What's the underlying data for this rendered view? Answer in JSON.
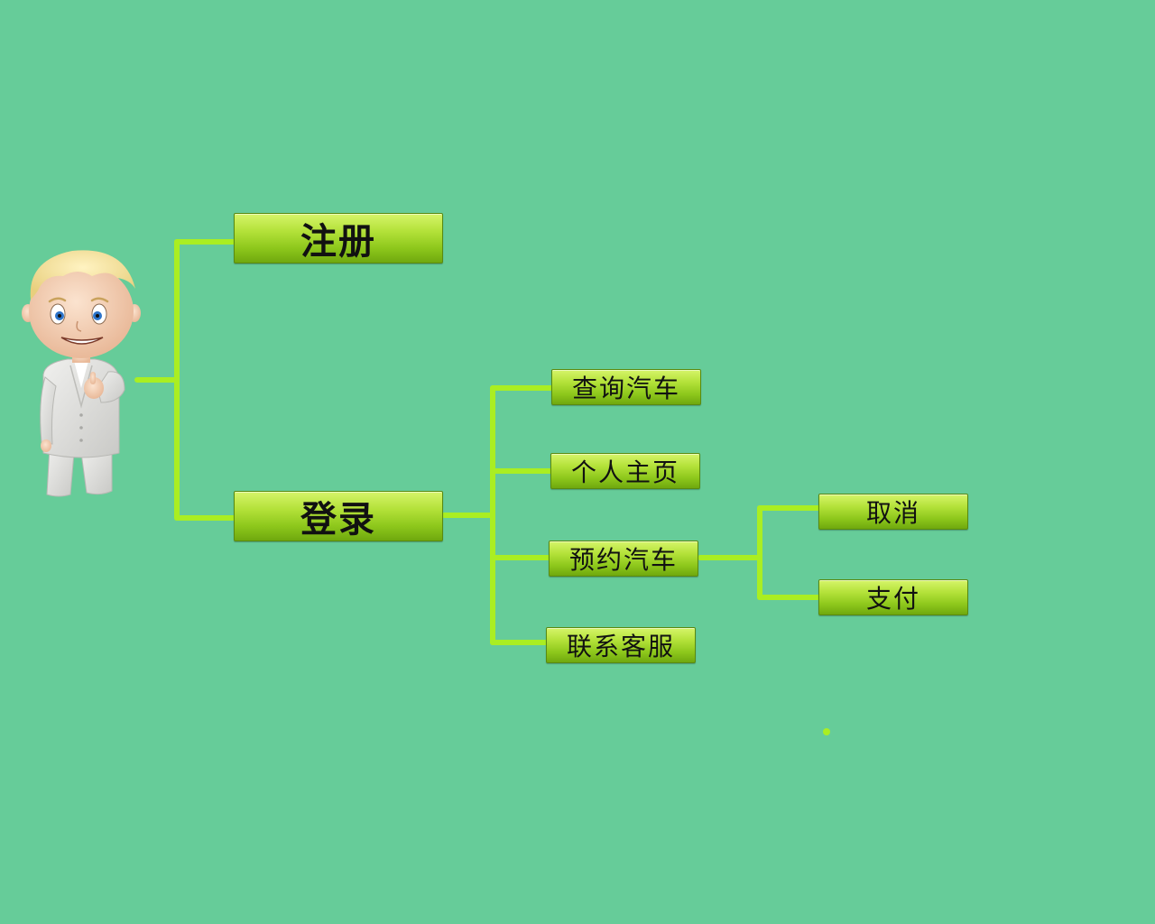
{
  "colors": {
    "background": "#66cc99",
    "connector": "#aaee22",
    "node_fill_top": "#d6f56a",
    "node_fill_bottom": "#6fa80e"
  },
  "avatar": {
    "icon": "cartoon-businessman-thumbs-up-icon"
  },
  "mindmap": {
    "register": {
      "label": "注册"
    },
    "login": {
      "label": "登录",
      "children": [
        {
          "label": "查询汽车"
        },
        {
          "label": "个人主页"
        },
        {
          "label": "预约汽车",
          "children": [
            {
              "label": "取消"
            },
            {
              "label": "支付"
            }
          ]
        },
        {
          "label": "联系客服"
        }
      ]
    }
  }
}
